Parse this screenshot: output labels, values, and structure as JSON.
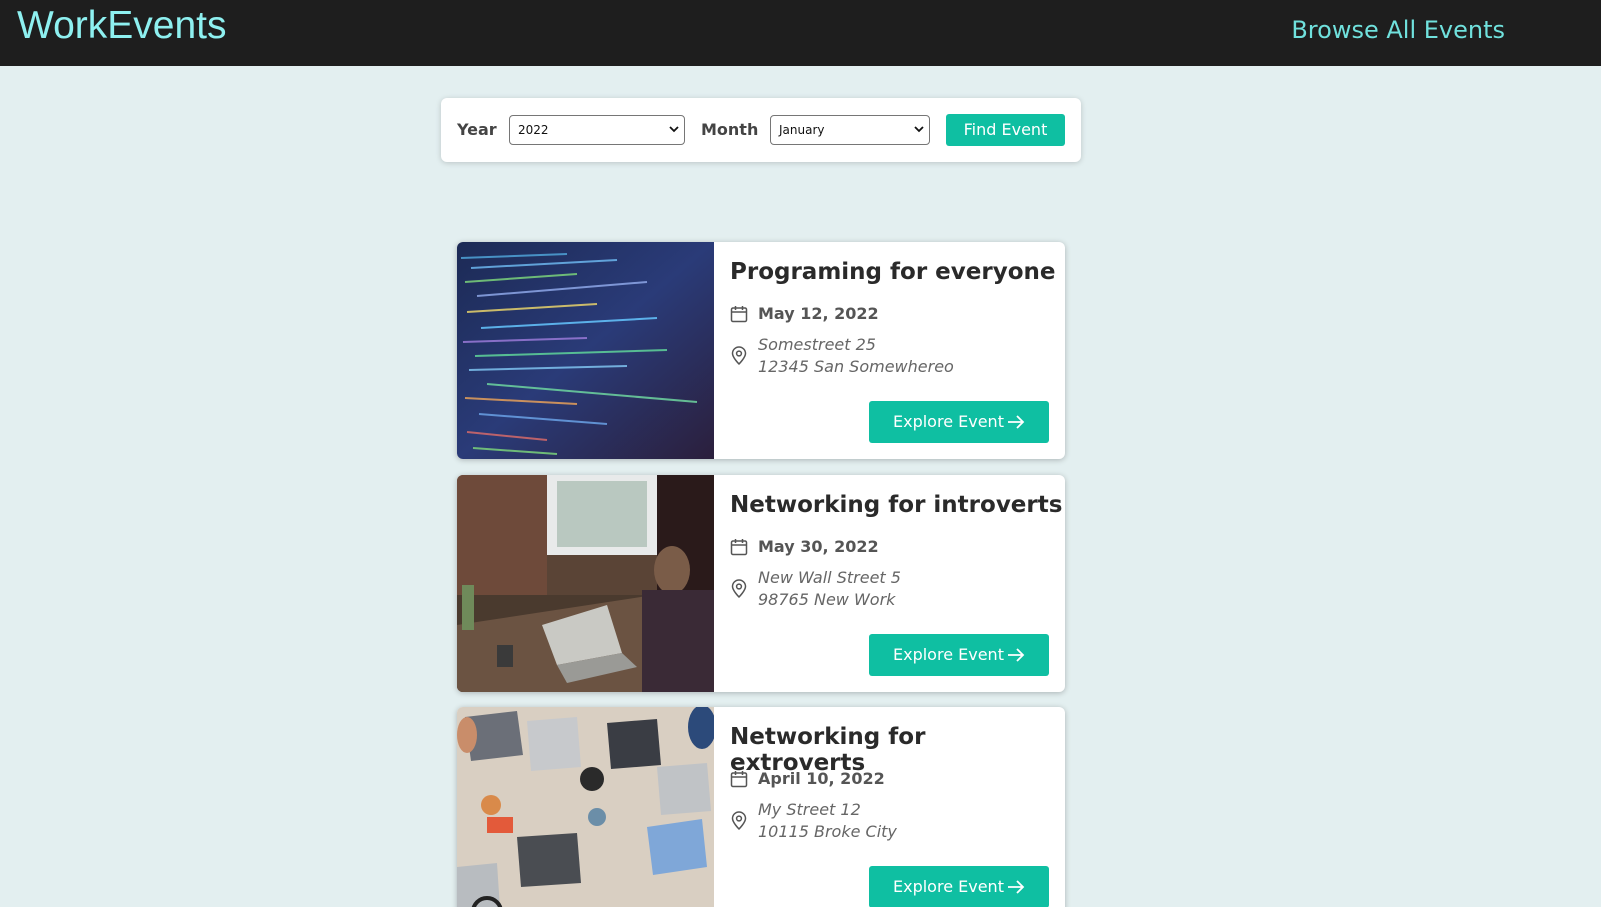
{
  "header": {
    "logo": "WorkEvents",
    "nav_link": "Browse All Events"
  },
  "filter": {
    "year_label": "Year",
    "year_value": "2022",
    "month_label": "Month",
    "month_value": "January",
    "submit_label": "Find Event"
  },
  "events": [
    {
      "title": "Programing for everyone",
      "date": "May 12, 2022",
      "address_line1": "Somestreet 25",
      "address_line2": "12345 San Somewhereo",
      "button_label": "Explore Event"
    },
    {
      "title": "Networking for introverts",
      "date": "May 30, 2022",
      "address_line1": "New Wall Street 5",
      "address_line2": "98765 New Work",
      "button_label": "Explore Event"
    },
    {
      "title": "Networking for extroverts",
      "date": "April 10, 2022",
      "address_line1": "My Street 12",
      "address_line2": "10115 Broke City",
      "button_label": "Explore Event"
    }
  ],
  "colors": {
    "accent": "#0fbfa2",
    "header_bg": "#1e1e1e",
    "logo": "#8ef0f0",
    "page_bg": "#e3eff0"
  },
  "icons": {
    "date": "calendar-icon",
    "location": "map-pin-icon",
    "button": "arrow-right-icon",
    "select": "chevron-down-icon"
  }
}
